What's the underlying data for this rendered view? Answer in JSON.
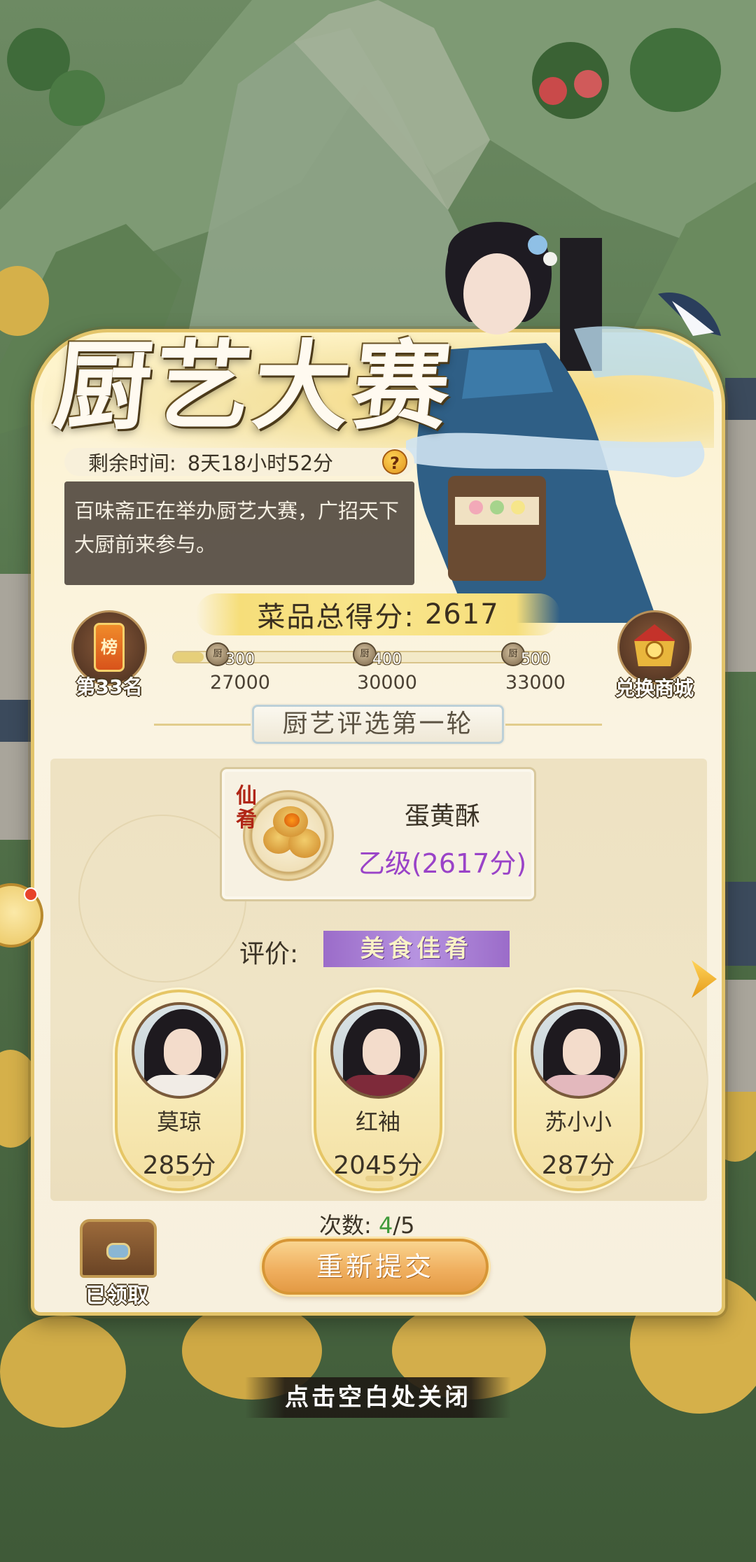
{
  "title": "厨艺大赛",
  "timer": {
    "label": "剩余时间:",
    "value": "8天18小时52分",
    "help": "?"
  },
  "description": "百味斋正在举办厨艺大赛，广招天下大厨前来参与。",
  "total_score": {
    "label": "菜品总得分:",
    "value": "2617"
  },
  "rank": {
    "badge": "榜",
    "label": "第33名"
  },
  "shop": {
    "label": "兑换商城"
  },
  "progress": {
    "current": 2617,
    "milestones": [
      {
        "reward": "300",
        "threshold": "27000"
      },
      {
        "reward": "400",
        "threshold": "30000"
      },
      {
        "reward": "500",
        "threshold": "33000"
      }
    ]
  },
  "round": {
    "label": "厨艺评选第一轮"
  },
  "dish": {
    "tag": "仙肴",
    "name": "蛋黄酥",
    "grade": "乙级(2617分)"
  },
  "evaluation": {
    "label": "评价:",
    "value": "美食佳肴"
  },
  "judges": [
    {
      "name": "莫琼",
      "score": "285分"
    },
    {
      "name": "红袖",
      "score": "2045分"
    },
    {
      "name": "苏小小",
      "score": "287分"
    }
  ],
  "attempts": {
    "label": "次数:",
    "used": "4",
    "total": "/5"
  },
  "chest": {
    "label": "已领取"
  },
  "resubmit_label": "重新提交",
  "close_hint": "点击空白处关闭",
  "colors": {
    "grade": "#9a43c8",
    "attempts_used": "#3f9a3a",
    "panel_border": "#e3c46a"
  }
}
